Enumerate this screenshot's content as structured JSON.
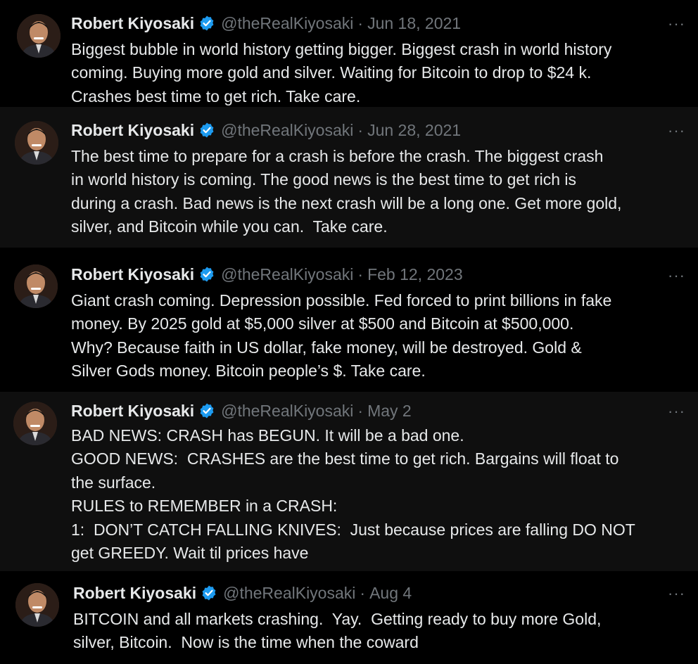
{
  "tweets": [
    {
      "author": "Robert Kiyosaki",
      "handle": "@theRealKiyosaki",
      "separator": "·",
      "date": "Jun 18, 2021",
      "more": "···",
      "text": "Biggest bubble in world history getting bigger. Biggest crash in world history\ncoming. Buying more gold and silver. Waiting for Bitcoin to drop to $24 k.\nCrashes best time to get rich. Take care."
    },
    {
      "author": "Robert Kiyosaki",
      "handle": "@theRealKiyosaki",
      "separator": "·",
      "date": "Jun 28, 2021",
      "more": "···",
      "text": "The best time to prepare for a crash is before the crash. The biggest crash\nin world history is coming. The good news is the best time to get rich is\nduring a crash. Bad news is the next crash will be a long one. Get more gold,\nsilver, and Bitcoin while you can.  Take care."
    },
    {
      "author": "Robert Kiyosaki",
      "handle": "@theRealKiyosaki",
      "separator": "·",
      "date": "Feb 12, 2023",
      "more": "···",
      "text": "Giant crash coming. Depression possible. Fed forced to print billions in fake\nmoney. By 2025 gold at $5,000 silver at $500 and Bitcoin at $500,000.\nWhy? Because faith in US dollar, fake money, will be destroyed. Gold &\nSilver Gods money. Bitcoin people’s $. Take care."
    },
    {
      "author": "Robert Kiyosaki",
      "handle": "@theRealKiyosaki",
      "separator": "·",
      "date": "May 2",
      "more": "···",
      "text": "BAD NEWS: CRASH has BEGUN. It will be a bad one.\nGOOD NEWS:  CRASHES are the best time to get rich. Bargains will float to\nthe surface.\nRULES to REMEMBER in a CRASH:\n1:  DON’T CATCH FALLING KNIVES:  Just because prices are falling DO NOT\nget GREEDY. Wait til prices have"
    },
    {
      "author": "Robert Kiyosaki",
      "handle": "@theRealKiyosaki",
      "separator": "·",
      "date": "Aug 4",
      "more": "···",
      "text": "BITCOIN and all markets crashing.  Yay.  Getting ready to buy more Gold,\nsilver, Bitcoin.  Now is the time when the coward"
    }
  ]
}
